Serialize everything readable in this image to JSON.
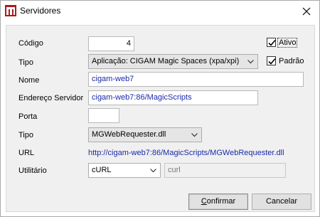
{
  "window": {
    "title": "Servidores",
    "icon": "app-logo-icon"
  },
  "form": {
    "codigo": {
      "label": "Código",
      "value": "4"
    },
    "ativo": {
      "label": "Ativo",
      "checked": true
    },
    "tipo_app": {
      "label": "Tipo",
      "value": "Aplicação: CIGAM Magic Spaces (xpa/xpi)"
    },
    "padrao": {
      "label": "Padrão",
      "checked": true
    },
    "nome": {
      "label": "Nome",
      "value": "cigam-web7"
    },
    "endereco": {
      "label": "Endereço Servidor",
      "value": "cigam-web7:86/MagicScripts"
    },
    "porta": {
      "label": "Porta",
      "value": ""
    },
    "tipo_req": {
      "label": "Tipo",
      "value": "MGWebRequester.dll"
    },
    "url": {
      "label": "URL",
      "value": "http://cigam-web7:86/MagicScripts/MGWebRequester.dll"
    },
    "utilitario": {
      "label": "Utilitário",
      "value": "cURL",
      "extra": "curl"
    }
  },
  "buttons": {
    "confirm": "Confirmar",
    "confirm_accel": "C",
    "confirm_rest": "onfirmar",
    "cancel": "Cancelar"
  },
  "colors": {
    "link_text": "#1a2aa8",
    "face": "#f0f0f0"
  }
}
